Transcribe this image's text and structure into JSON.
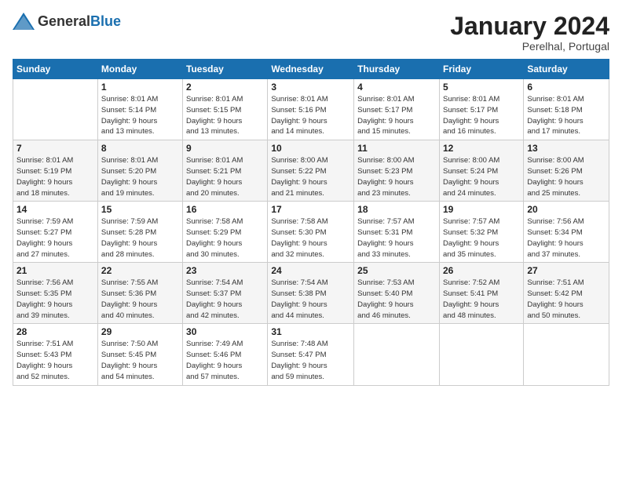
{
  "header": {
    "logo_general": "General",
    "logo_blue": "Blue",
    "month_title": "January 2024",
    "location": "Perelhal, Portugal"
  },
  "weekdays": [
    "Sunday",
    "Monday",
    "Tuesday",
    "Wednesday",
    "Thursday",
    "Friday",
    "Saturday"
  ],
  "weeks": [
    [
      {
        "day": "",
        "info": ""
      },
      {
        "day": "1",
        "info": "Sunrise: 8:01 AM\nSunset: 5:14 PM\nDaylight: 9 hours\nand 13 minutes."
      },
      {
        "day": "2",
        "info": "Sunrise: 8:01 AM\nSunset: 5:15 PM\nDaylight: 9 hours\nand 13 minutes."
      },
      {
        "day": "3",
        "info": "Sunrise: 8:01 AM\nSunset: 5:16 PM\nDaylight: 9 hours\nand 14 minutes."
      },
      {
        "day": "4",
        "info": "Sunrise: 8:01 AM\nSunset: 5:17 PM\nDaylight: 9 hours\nand 15 minutes."
      },
      {
        "day": "5",
        "info": "Sunrise: 8:01 AM\nSunset: 5:17 PM\nDaylight: 9 hours\nand 16 minutes."
      },
      {
        "day": "6",
        "info": "Sunrise: 8:01 AM\nSunset: 5:18 PM\nDaylight: 9 hours\nand 17 minutes."
      }
    ],
    [
      {
        "day": "7",
        "info": "Sunrise: 8:01 AM\nSunset: 5:19 PM\nDaylight: 9 hours\nand 18 minutes."
      },
      {
        "day": "8",
        "info": "Sunrise: 8:01 AM\nSunset: 5:20 PM\nDaylight: 9 hours\nand 19 minutes."
      },
      {
        "day": "9",
        "info": "Sunrise: 8:01 AM\nSunset: 5:21 PM\nDaylight: 9 hours\nand 20 minutes."
      },
      {
        "day": "10",
        "info": "Sunrise: 8:00 AM\nSunset: 5:22 PM\nDaylight: 9 hours\nand 21 minutes."
      },
      {
        "day": "11",
        "info": "Sunrise: 8:00 AM\nSunset: 5:23 PM\nDaylight: 9 hours\nand 23 minutes."
      },
      {
        "day": "12",
        "info": "Sunrise: 8:00 AM\nSunset: 5:24 PM\nDaylight: 9 hours\nand 24 minutes."
      },
      {
        "day": "13",
        "info": "Sunrise: 8:00 AM\nSunset: 5:26 PM\nDaylight: 9 hours\nand 25 minutes."
      }
    ],
    [
      {
        "day": "14",
        "info": "Sunrise: 7:59 AM\nSunset: 5:27 PM\nDaylight: 9 hours\nand 27 minutes."
      },
      {
        "day": "15",
        "info": "Sunrise: 7:59 AM\nSunset: 5:28 PM\nDaylight: 9 hours\nand 28 minutes."
      },
      {
        "day": "16",
        "info": "Sunrise: 7:58 AM\nSunset: 5:29 PM\nDaylight: 9 hours\nand 30 minutes."
      },
      {
        "day": "17",
        "info": "Sunrise: 7:58 AM\nSunset: 5:30 PM\nDaylight: 9 hours\nand 32 minutes."
      },
      {
        "day": "18",
        "info": "Sunrise: 7:57 AM\nSunset: 5:31 PM\nDaylight: 9 hours\nand 33 minutes."
      },
      {
        "day": "19",
        "info": "Sunrise: 7:57 AM\nSunset: 5:32 PM\nDaylight: 9 hours\nand 35 minutes."
      },
      {
        "day": "20",
        "info": "Sunrise: 7:56 AM\nSunset: 5:34 PM\nDaylight: 9 hours\nand 37 minutes."
      }
    ],
    [
      {
        "day": "21",
        "info": "Sunrise: 7:56 AM\nSunset: 5:35 PM\nDaylight: 9 hours\nand 39 minutes."
      },
      {
        "day": "22",
        "info": "Sunrise: 7:55 AM\nSunset: 5:36 PM\nDaylight: 9 hours\nand 40 minutes."
      },
      {
        "day": "23",
        "info": "Sunrise: 7:54 AM\nSunset: 5:37 PM\nDaylight: 9 hours\nand 42 minutes."
      },
      {
        "day": "24",
        "info": "Sunrise: 7:54 AM\nSunset: 5:38 PM\nDaylight: 9 hours\nand 44 minutes."
      },
      {
        "day": "25",
        "info": "Sunrise: 7:53 AM\nSunset: 5:40 PM\nDaylight: 9 hours\nand 46 minutes."
      },
      {
        "day": "26",
        "info": "Sunrise: 7:52 AM\nSunset: 5:41 PM\nDaylight: 9 hours\nand 48 minutes."
      },
      {
        "day": "27",
        "info": "Sunrise: 7:51 AM\nSunset: 5:42 PM\nDaylight: 9 hours\nand 50 minutes."
      }
    ],
    [
      {
        "day": "28",
        "info": "Sunrise: 7:51 AM\nSunset: 5:43 PM\nDaylight: 9 hours\nand 52 minutes."
      },
      {
        "day": "29",
        "info": "Sunrise: 7:50 AM\nSunset: 5:45 PM\nDaylight: 9 hours\nand 54 minutes."
      },
      {
        "day": "30",
        "info": "Sunrise: 7:49 AM\nSunset: 5:46 PM\nDaylight: 9 hours\nand 57 minutes."
      },
      {
        "day": "31",
        "info": "Sunrise: 7:48 AM\nSunset: 5:47 PM\nDaylight: 9 hours\nand 59 minutes."
      },
      {
        "day": "",
        "info": ""
      },
      {
        "day": "",
        "info": ""
      },
      {
        "day": "",
        "info": ""
      }
    ]
  ]
}
